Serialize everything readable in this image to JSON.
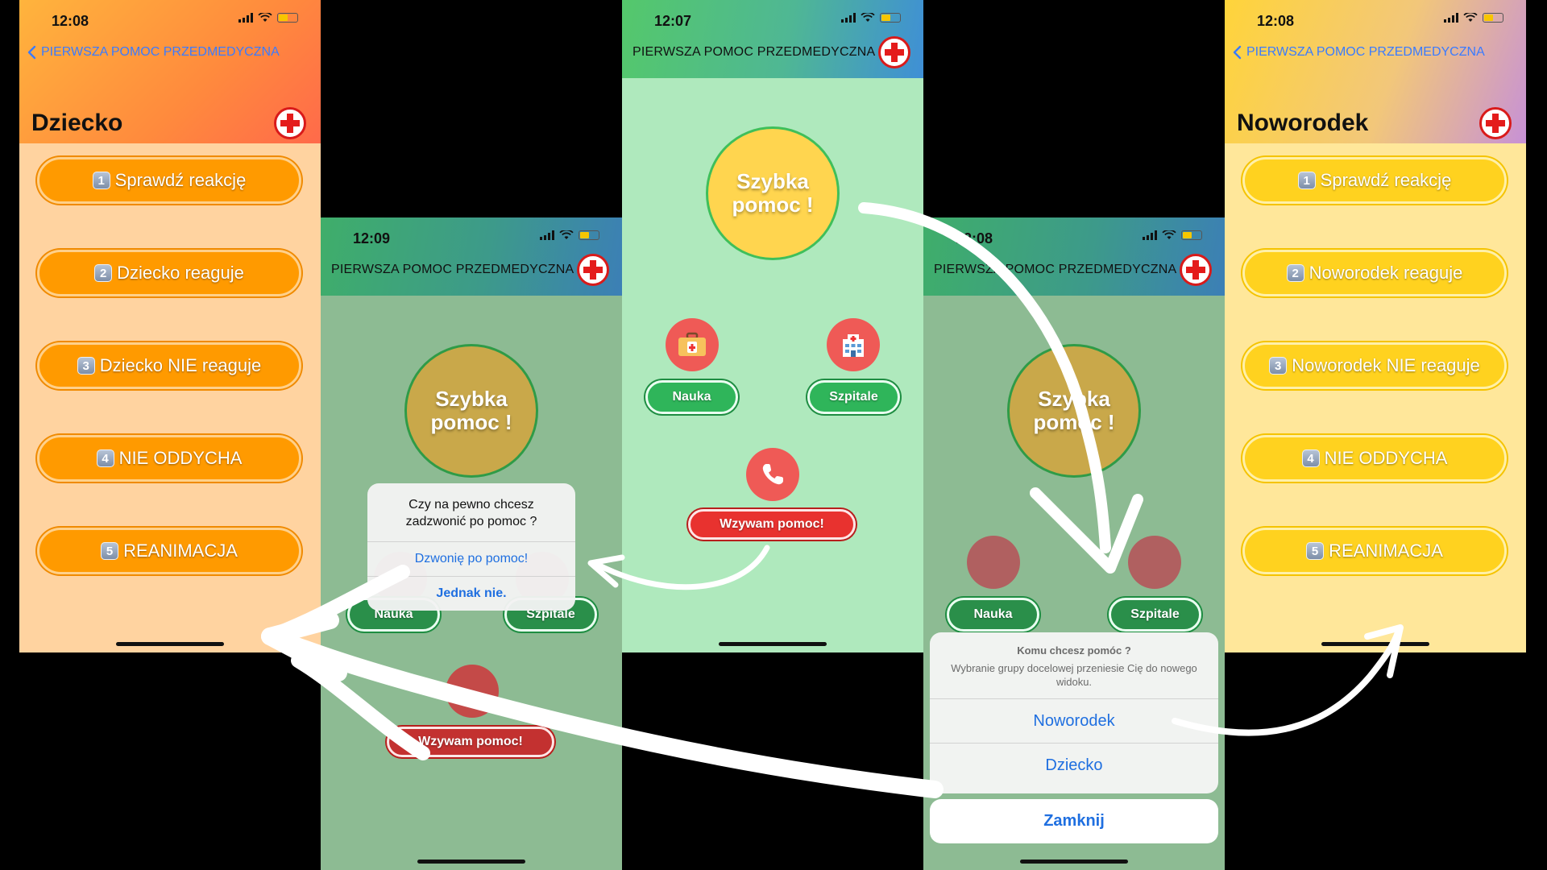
{
  "screen1": {
    "time": "12:08",
    "back_label": "PIERWSZA POMOC PRZEDMEDYCZNA",
    "title": "Dziecko",
    "items": [
      {
        "num": "1",
        "label": "Sprawdź reakcję"
      },
      {
        "num": "2",
        "label": "Dziecko reaguje"
      },
      {
        "num": "3",
        "label": "Dziecko NIE reaguje"
      },
      {
        "num": "4",
        "label": "NIE ODDYCHA"
      },
      {
        "num": "5",
        "label": "REANIMACJA"
      }
    ]
  },
  "screen2": {
    "time": "12:09",
    "nav_title": "PIERWSZA POMOC PRZEDMEDYCZNA",
    "quick_help": "Szybka pomoc !",
    "learn_label": "Nauka",
    "hospitals_label": "Szpitale",
    "call_label": "Wzywam pomoc!",
    "alert": {
      "message": "Czy na pewno chcesz zadzwonić po pomoc ?",
      "confirm": "Dzwonię po pomoc!",
      "cancel": "Jednak nie."
    }
  },
  "screen3": {
    "time": "12:07",
    "nav_title": "PIERWSZA POMOC PRZEDMEDYCZNA",
    "quick_help": "Szybka pomoc !",
    "learn_label": "Nauka",
    "hospitals_label": "Szpitale",
    "call_label": "Wzywam pomoc!"
  },
  "screen4": {
    "time": "12:08",
    "nav_title": "PIERWSZA POMOC PRZEDMEDYCZNA",
    "quick_help": "Szybka pomoc !",
    "learn_label": "Nauka",
    "hospitals_label": "Szpitale",
    "sheet": {
      "title": "Komu chcesz pomóc ?",
      "subtitle": "Wybranie grupy docelowej przeniesie Cię do nowego widoku.",
      "option1": "Noworodek",
      "option2": "Dziecko",
      "close": "Zamknij"
    }
  },
  "screen5": {
    "time": "12:08",
    "back_label": "PIERWSZA POMOC PRZEDMEDYCZNA",
    "title": "Noworodek",
    "items": [
      {
        "num": "1",
        "label": "Sprawdź reakcję"
      },
      {
        "num": "2",
        "label": "Noworodek reaguje"
      },
      {
        "num": "3",
        "label": "Noworodek NIE reaguje"
      },
      {
        "num": "4",
        "label": "NIE ODDYCHA"
      },
      {
        "num": "5",
        "label": "REANIMACJA"
      }
    ]
  },
  "colors": {
    "orange_button": "#ff9a00",
    "yellow_button": "#ffd21f",
    "green_bg": "#afe9bd",
    "dim_green_bg": "#8dbb93",
    "red": "#e8322f",
    "link_blue": "#1f6fe0"
  }
}
